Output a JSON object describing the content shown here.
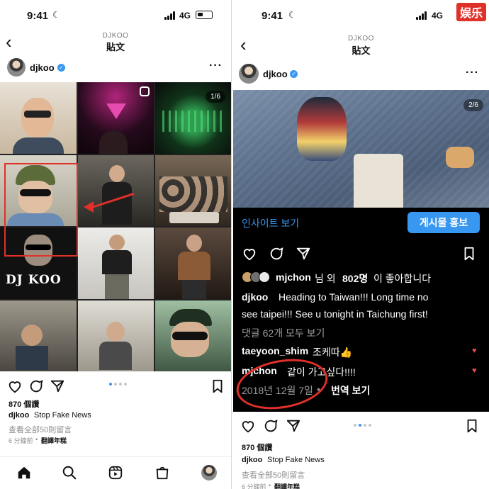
{
  "left": {
    "status": {
      "time": "9:41",
      "network": "4G"
    },
    "nav": {
      "username": "DJKOO",
      "title": "貼文"
    },
    "post": {
      "username": "djkoo",
      "counter": "1/6"
    },
    "grid_cells": [
      {
        "bg": "#cdbfae"
      },
      {
        "bg": "#1a0b14"
      },
      {
        "bg": "#2a2020"
      },
      {
        "bg": "#b7b3a5"
      },
      {
        "bg": "#3c3934"
      },
      {
        "bg": "#4a3e33"
      },
      {
        "bg": "#141414"
      },
      {
        "bg": "#d9d7d2"
      },
      {
        "bg": "#2e2722"
      },
      {
        "bg": "#5e5a52"
      },
      {
        "bg": "#bfbab0"
      },
      {
        "bg": "#86a08a"
      }
    ],
    "dj_logo": "DJ KOO",
    "likes": "870 個讚",
    "caption_user": "djkoo",
    "caption": "Stop Fake News",
    "view_comments": "查看全部50則留言",
    "time_ago": "6 分鐘前",
    "translate": "翻譯年糕"
  },
  "right": {
    "status": {
      "time": "9:41",
      "network": "4G"
    },
    "brand_tag": "娱乐",
    "nav": {
      "username": "DJKOO",
      "title": "貼文"
    },
    "post": {
      "username": "djkoo",
      "counter": "2/6"
    },
    "insight": "인사이트 보기",
    "promote": "게시물 홍보",
    "liked_by_user": "mjchon",
    "liked_by_rest": "님 외 ",
    "liked_count": "802명",
    "liked_suffix": "이 좋아합니다",
    "caption_user": "djkoo",
    "caption_line1": "Heading to Taiwan!!! Long time no",
    "caption_line2": "see taipei!!! See u tonight in Taichung first!",
    "view_comments": "댓글 62개 모두 보기",
    "comments": [
      {
        "user": "taeyoon_shim",
        "text": "조케따👍"
      },
      {
        "user": "mjchon",
        "text": "같이 가고싶다!!!!"
      }
    ],
    "date": "2018년 12월 7일",
    "separator": " • ",
    "translate": "번역 보기",
    "likes": "870 個讚",
    "caption_user2": "djkoo",
    "caption2": "Stop Fake News",
    "view_comments2": "查看全部50則留言",
    "time_ago": "6 分鐘前",
    "translate2": "翻譯年糕"
  },
  "colors": {
    "accent": "#3897f0",
    "annotation": "#e0302a",
    "heart": "#ed4956"
  }
}
